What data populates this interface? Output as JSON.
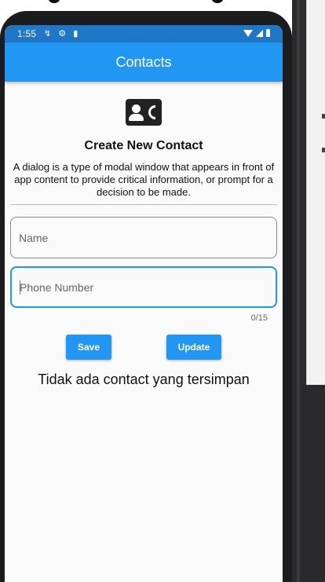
{
  "status_bar": {
    "time": "1:55",
    "left_icons": [
      "↯",
      "⚙",
      "▮"
    ],
    "right_icons": [
      "wifi-icon",
      "signal-icon",
      "battery-icon"
    ]
  },
  "app_bar": {
    "title": "Contacts",
    "color": "#2196f3"
  },
  "header": {
    "icon": "contact-phone-icon",
    "title": "Create New Contact",
    "description": "A dialog is a type of modal window that appears in front of app content to provide critical information, or prompt for a decision to be made."
  },
  "form": {
    "name": {
      "value": "",
      "placeholder": "Name"
    },
    "phone": {
      "value": "",
      "placeholder": "Phone Number",
      "counter": "0/15"
    }
  },
  "buttons": {
    "save_label": "Save",
    "update_label": "Update"
  },
  "empty_message": "Tidak ada contact yang tersimpan"
}
